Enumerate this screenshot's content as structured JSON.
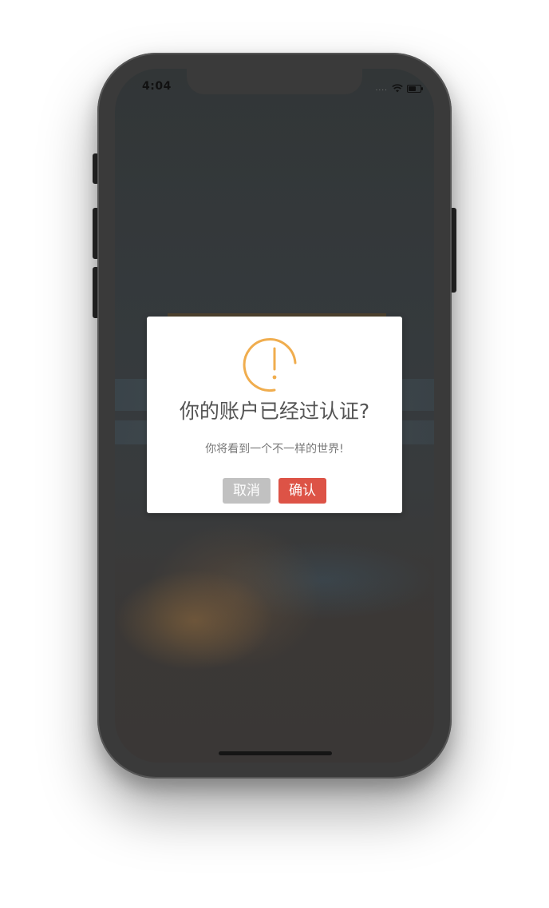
{
  "status_bar": {
    "time": "4:04",
    "signal": "....",
    "wifi_icon": "wifi-icon",
    "battery_icon": "battery-icon"
  },
  "dialog": {
    "icon": "warning-icon",
    "icon_color": "#f0ad4e",
    "title": "你的账户已经过认证?",
    "text": "你将看到一个不一样的世界!",
    "cancel_label": "取消",
    "confirm_label": "确认",
    "cancel_color": "#c1c1c1",
    "confirm_color": "#dd5346"
  }
}
